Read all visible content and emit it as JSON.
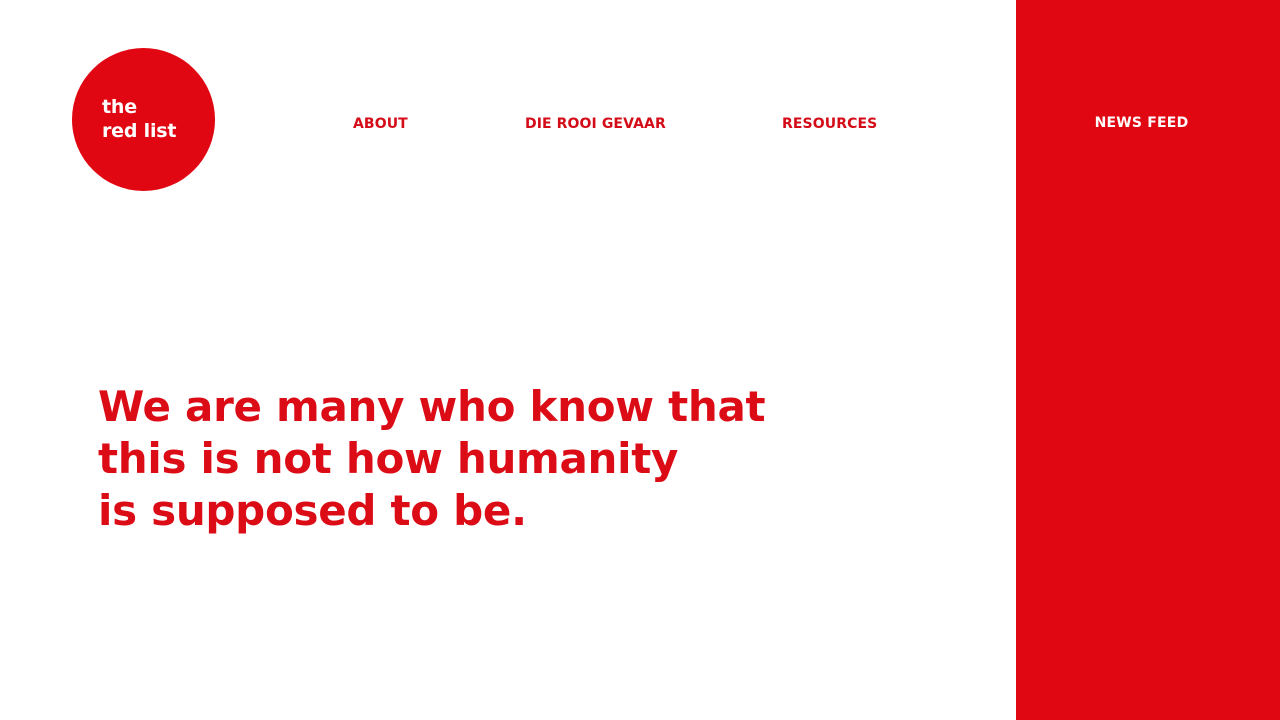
{
  "brand": {
    "logo_line1": "the",
    "logo_line2": "red list",
    "color": "#e10712"
  },
  "nav": {
    "items": [
      {
        "label": "ABOUT"
      },
      {
        "label": "DIE ROOI GEVAAR"
      },
      {
        "label": "RESOURCES"
      }
    ],
    "news_feed": "NEWS FEED"
  },
  "hero": {
    "lines": [
      "We are many who know that",
      "this is not how humanity",
      "is supposed to be."
    ]
  },
  "colors": {
    "accent": "#e10712",
    "background": "#ffffff",
    "panel_text": "#ffffff"
  }
}
